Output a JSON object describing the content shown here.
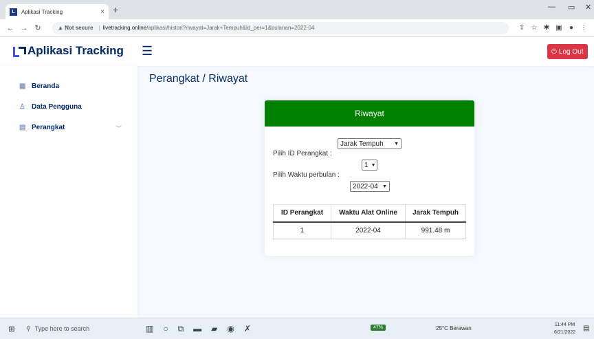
{
  "browser": {
    "tab_title": "Aplikasi Tracking",
    "tab_close": "×",
    "new_tab": "+",
    "url_warning": "▲ Not secure",
    "url_host": "livetracking.online",
    "url_path": "/aplikasi/histori?riwayat=Jarak+Tempuh&id_per=1&bulanan=2022-04",
    "win_min": "—",
    "win_max": "▭",
    "win_close": "✕"
  },
  "header": {
    "brand": "Aplikasi Tracking",
    "logout_label": "Log Out"
  },
  "sidebar": {
    "items": [
      {
        "label": "Beranda",
        "icon": "grid-icon"
      },
      {
        "label": "Data Pengguna",
        "icon": "user-icon"
      },
      {
        "label": "Perangkat",
        "icon": "layout-icon"
      }
    ]
  },
  "main": {
    "page_title": "Perangkat / Riwayat",
    "card_title": "Riwayat",
    "history_type_select": "Jarak Tempuh",
    "device_label": "Pilih ID Perangkat :",
    "device_select": "1",
    "month_label": "Pilih Waktu perbulan :",
    "month_select": "2022-04",
    "table": {
      "headers": [
        "ID Perangkat",
        "Waktu Alat Online",
        "Jarak Tempuh"
      ],
      "rows": [
        [
          "1",
          "2022-04",
          "991.48 m"
        ]
      ]
    }
  },
  "taskbar": {
    "search_placeholder": "Type here to search",
    "battery_badge": "47%",
    "weather": "25°C  Berawan",
    "time": "11:44 PM",
    "date": "6/21/2022"
  },
  "colors": {
    "card_header": "#008000",
    "logout": "#dc3545",
    "brand": "#012970"
  }
}
